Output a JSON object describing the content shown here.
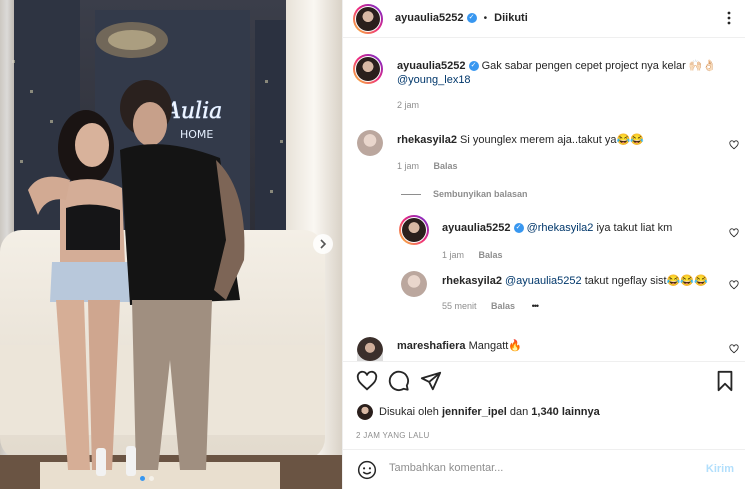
{
  "post": {
    "author": "ayuaulia5252",
    "follow_status": "Diikuti",
    "caption_text": "Gak sabar pengen cepet project nya kelar 🙌🏻👌🏻",
    "caption_mention": "@young_lex18",
    "caption_time": "2 jam",
    "likes_prefix": "Disukai oleh",
    "likes_user": "jennifer_ipel",
    "likes_suffix": "dan",
    "likes_count": "1,340 lainnya",
    "posted_ago": "2 JAM YANG LALU"
  },
  "comments": [
    {
      "user": "rhekasyila2",
      "text": "Si younglex merem aja..takut ya😂😂",
      "time": "1 jam",
      "reply_label": "Balas",
      "hide_replies": "Sembunyikan balasan",
      "replies": [
        {
          "user": "ayuaulia5252",
          "mention": "@rhekasyila2",
          "text": "iya takut liat km",
          "time": "1 jam",
          "reply_label": "Balas"
        },
        {
          "user": "rhekasyila2",
          "mention": "@ayuaulia5252",
          "text": "takut ngeflay sist😂😂😂",
          "time": "55 menit",
          "reply_label": "Balas",
          "more": "•••"
        }
      ]
    },
    {
      "user": "mareshafiera",
      "text": "Mangatt🔥"
    }
  ],
  "composer": {
    "placeholder": "Tambahkan komentar...",
    "submit_label": "Kirim"
  },
  "photo": {
    "neon_sign": "Aulia",
    "neon_sign_2": "HOME"
  },
  "colors": {
    "accent": "#3897f0",
    "text": "#262626",
    "muted": "#8e8e8e",
    "link": "#00376b"
  }
}
